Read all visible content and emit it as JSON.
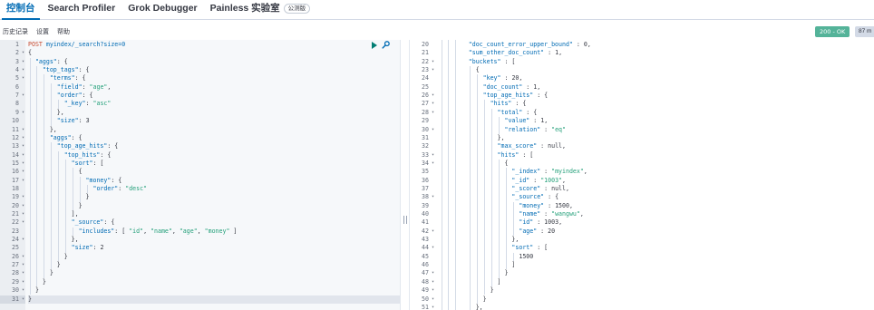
{
  "tabs": [
    {
      "label": "控制台",
      "active": true
    },
    {
      "label": "Search Profiler"
    },
    {
      "label": "Grok Debugger"
    },
    {
      "label": "Painless 实验室",
      "badge": "公测版"
    }
  ],
  "menu": {
    "history": "历史记录",
    "settings": "设置",
    "help": "帮助"
  },
  "status": {
    "text": "200 - OK",
    "timing": "87 m",
    "color": "#54b399"
  },
  "request": {
    "first_line": 1,
    "selected_line": 31,
    "lines": [
      "POST myindex/_search?size=0",
      "{",
      "  \"aggs\": {",
      "    \"top_tags\": {",
      "      \"terms\": {",
      "        \"field\": \"age\",",
      "        \"order\": {",
      "          \"_key\": \"asc\"",
      "        },",
      "        \"size\": 3",
      "      },",
      "      \"aggs\": {",
      "        \"top_age_hits\": {",
      "          \"top_hits\": {",
      "            \"sort\": [",
      "              {",
      "                \"money\": {",
      "                  \"order\": \"desc\"",
      "                }",
      "              }",
      "            ],",
      "            \"_source\": {",
      "              \"includes\": [ \"id\", \"name\", \"age\", \"money\" ]",
      "            },",
      "            \"size\": 2",
      "          }",
      "        }",
      "      }",
      "    }",
      "  }",
      "}"
    ],
    "folds": [
      2,
      3,
      4,
      5,
      7,
      9,
      11,
      12,
      13,
      14,
      15,
      16,
      17,
      19,
      20,
      21,
      22,
      24,
      26,
      27,
      28,
      29,
      30,
      31
    ]
  },
  "response": {
    "first_line": 20,
    "lines": [
      "        \"doc_count_error_upper_bound\" : 0,",
      "        \"sum_other_doc_count\" : 1,",
      "        \"buckets\" : [",
      "          {",
      "            \"key\" : 20,",
      "            \"doc_count\" : 1,",
      "            \"top_age_hits\" : {",
      "              \"hits\" : {",
      "                \"total\" : {",
      "                  \"value\" : 1,",
      "                  \"relation\" : \"eq\"",
      "                },",
      "                \"max_score\" : null,",
      "                \"hits\" : [",
      "                  {",
      "                    \"_index\" : \"myindex\",",
      "                    \"_id\" : \"1003\",",
      "                    \"_score\" : null,",
      "                    \"_source\" : {",
      "                      \"money\" : 1500,",
      "                      \"name\" : \"wangwu\",",
      "                      \"id\" : 1003,",
      "                      \"age\" : 20",
      "                    },",
      "                    \"sort\" : [",
      "                      1500",
      "                    ]",
      "                  }",
      "                ]",
      "              }",
      "            }",
      "          },"
    ],
    "folds": [
      22,
      23,
      26,
      27,
      28,
      30,
      33,
      34,
      38,
      42,
      44,
      47,
      48,
      49,
      50,
      51
    ]
  }
}
